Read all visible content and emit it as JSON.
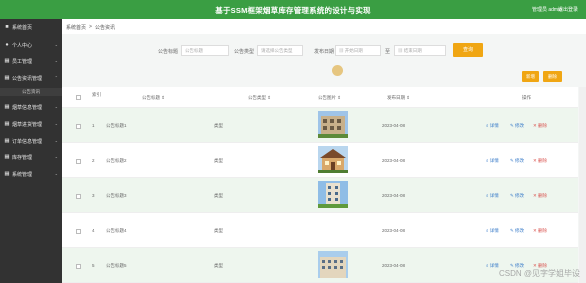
{
  "header": {
    "title": "基于SSM框架烟草库存管理系统的设计与实现",
    "user": "管理员 admin",
    "logout": "退出登录"
  },
  "sidebar": {
    "items": [
      {
        "label": "系统首页",
        "icon": "home-icon",
        "glyph": "■"
      },
      {
        "label": "个人中心",
        "icon": "user-icon",
        "glyph": "●"
      },
      {
        "label": "员工管理",
        "icon": "grid-icon",
        "glyph": "▦"
      },
      {
        "label": "公告资讯管理",
        "icon": "grid-icon",
        "glyph": "▦"
      },
      {
        "label": "烟草信息管理",
        "icon": "grid-icon",
        "glyph": "▦"
      },
      {
        "label": "烟草进货管理",
        "icon": "grid-icon",
        "glyph": "▦"
      },
      {
        "label": "订单信息管理",
        "icon": "grid-icon",
        "glyph": "▦"
      },
      {
        "label": "库存管理",
        "icon": "grid-icon",
        "glyph": "▦"
      },
      {
        "label": "系统管理",
        "icon": "grid-icon",
        "glyph": "▦"
      }
    ],
    "active_sub": "公告资讯"
  },
  "breadcrumb": {
    "home": "系统首页",
    "sep": ">",
    "current": "公告资讯"
  },
  "search": {
    "title_label": "公告标题",
    "title_placeholder": "公告标题",
    "type_label": "公告类型",
    "type_placeholder": "请选择公告类型",
    "date_label": "发布日期",
    "start_placeholder": "开始日期",
    "to": "至",
    "end_placeholder": "结束日期",
    "button": "查询"
  },
  "toolbar": {
    "add": "新增",
    "delete": "删除"
  },
  "table": {
    "columns": [
      "索引",
      "公告标题",
      "公告类型",
      "公告图片",
      "发布日期",
      "操作"
    ],
    "rows": [
      {
        "index": "1",
        "title": "公告标题1",
        "type": "类型",
        "date": "2023-04-08",
        "image": "building"
      },
      {
        "index": "2",
        "title": "公告标题2",
        "type": "类型",
        "date": "2023-04-08",
        "image": "house"
      },
      {
        "index": "3",
        "title": "公告标题3",
        "type": "类型",
        "date": "2023-04-08",
        "image": "tower"
      },
      {
        "index": "4",
        "title": "公告标题4",
        "type": "类型",
        "date": "2023-04-08",
        "image": "none"
      },
      {
        "index": "5",
        "title": "公告标题5",
        "type": "类型",
        "date": "2023-04-08",
        "image": "apartment"
      }
    ],
    "actions": {
      "view": "详情",
      "edit": "修改",
      "delete": "删除"
    }
  },
  "watermark": "CSDN @见字学姐毕设"
}
